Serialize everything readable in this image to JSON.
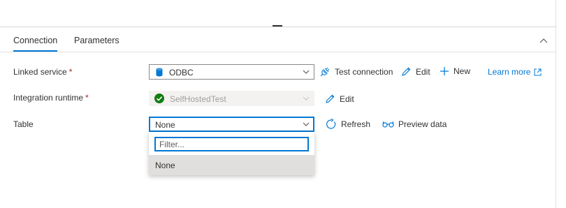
{
  "tabs": [
    {
      "label": "Connection",
      "active": true
    },
    {
      "label": "Parameters",
      "active": false
    }
  ],
  "form": {
    "linked_service": {
      "label": "Linked service",
      "required_mark": "*",
      "value": "ODBC",
      "icon": "database-icon",
      "actions": {
        "test_connection": "Test connection",
        "edit": "Edit",
        "new": "New",
        "learn_more": "Learn more"
      }
    },
    "integration_runtime": {
      "label": "Integration runtime",
      "required_mark": "*",
      "value": "SelfHostedTest",
      "disabled": true,
      "status_icon": "green-check-icon",
      "actions": {
        "edit": "Edit"
      }
    },
    "table": {
      "label": "Table",
      "value": "None",
      "actions": {
        "refresh": "Refresh",
        "preview": "Preview data"
      },
      "dropdown": {
        "filter_placeholder": "Filter...",
        "options": [
          "None"
        ]
      }
    }
  },
  "colors": {
    "accent": "#0078d4",
    "required": "#a4262c",
    "success": "#107c10",
    "text": "#323130"
  }
}
